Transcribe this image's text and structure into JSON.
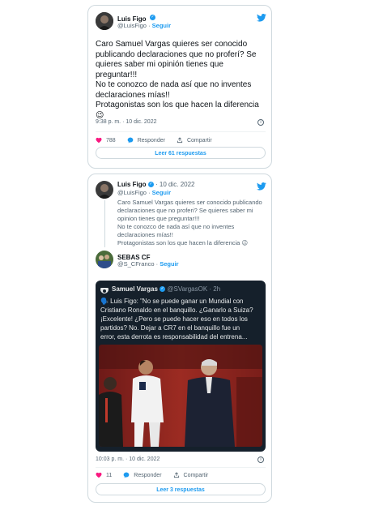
{
  "tweet1": {
    "author_name": "Luis Figo",
    "handle": "@LuisFigo",
    "follow": "Seguir",
    "lines": [
      "Caro Samuel Vargas quieres ser conocido",
      "publicando declaraciones que no proferí? Se",
      "quieres saber mi opinión tienes que",
      "preguntar!!!",
      "No te conozco de nada así que no inventes",
      "declaraciones mías!!",
      "Protagonistas son los que hacen la diferencia"
    ],
    "emoji": "😉",
    "timestamp": "9:38 p. m. · 10 dic. 2022",
    "likes": "788",
    "reply_label": "Responder",
    "share_label": "Compartir",
    "read_replies": "Leer 61 respuestas"
  },
  "tweet2": {
    "quoted_author": "Luis Figo",
    "quoted_date": "· 10 dic. 2022",
    "quoted_handle": "@LuisFigo",
    "quoted_follow": "Seguir",
    "quoted_lines": [
      "Caro Samuel Vargas quieres ser conocido publicando",
      "declaraciones que no proferi? Se quieres saber mi",
      "opinion tienes que preguntar!!!",
      "No te conozco de nada así que no inventes",
      "declaraciones mías!!",
      "Protagonistas son los que hacen la diferencia 😉"
    ],
    "author_name": "SEBAS CF",
    "handle": "@S_CFranco",
    "follow": "Seguir",
    "embedded": {
      "author_name": "Samuel Vargas",
      "handle": "@SVargasOK",
      "time": "· 2h",
      "lines": [
        "🗣️ Luis Figo: \"No se puede ganar un Mundial con",
        "Cristiano Ronaldo en el banquillo. ¿Ganarlo a Suiza?",
        "¡Excelente! ¿Pero se puede hacer eso en todos los",
        "partidos? No. Dejar a CR7 en el banquillo fue un",
        "error, esta derrota es responsabilidad del entrena..."
      ]
    },
    "timestamp": "10:03 p. m. · 10 dic. 2022",
    "likes": "11",
    "reply_label": "Responder",
    "share_label": "Compartir",
    "read_replies": "Leer 3 respuestas"
  },
  "colors": {
    "accent": "#1d9bf0",
    "like": "#f91880",
    "border": "#cfd9de",
    "muted": "#536471",
    "dark_card": "#15202b"
  }
}
